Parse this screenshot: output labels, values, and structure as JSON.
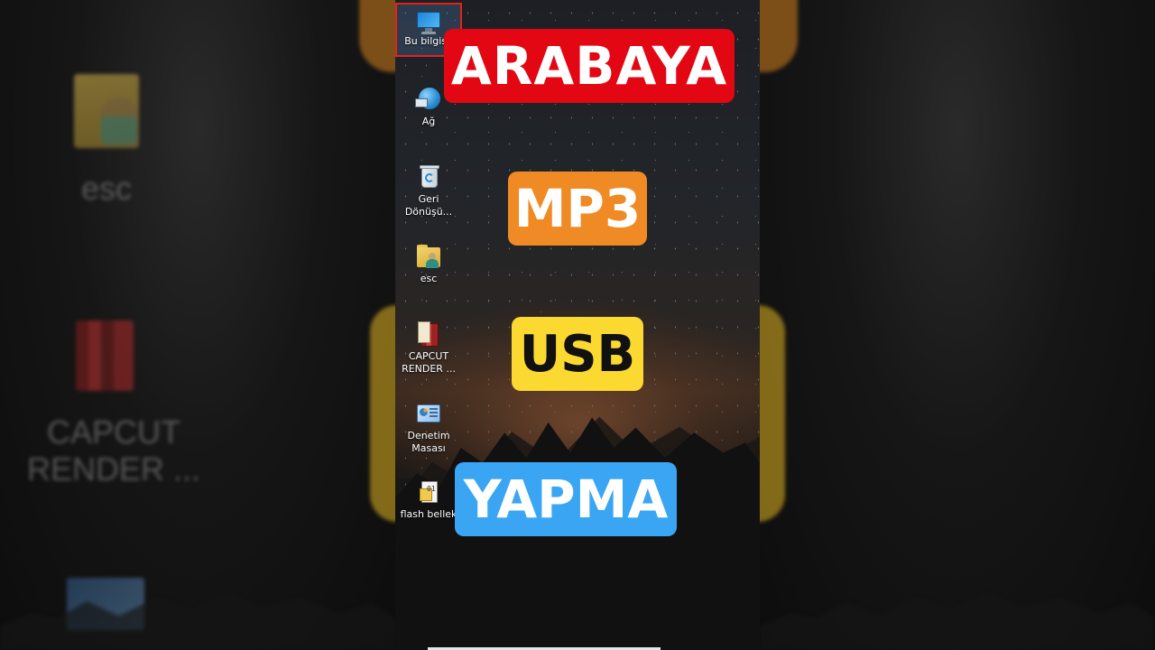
{
  "desktop_icons": [
    {
      "label": "Bu bilgisa",
      "icon": "computer-icon",
      "selected": true
    },
    {
      "label": "Ağ",
      "icon": "network-icon"
    },
    {
      "label": "Geri\nDönüşü...",
      "icon": "recycle-bin-icon"
    },
    {
      "label": "esc",
      "icon": "user-folder-icon"
    },
    {
      "label": "CAPCUT\nRENDER ...",
      "icon": "winrar-archive-icon"
    },
    {
      "label": "Denetim\nMasası",
      "icon": "control-panel-icon"
    },
    {
      "label": "flash bellek",
      "icon": "text-file-icon"
    }
  ],
  "captions": {
    "line1": "ARABAYA",
    "line2": "MP3",
    "line3": "USB",
    "line4": "YAPMA"
  },
  "background_blur": {
    "left_text_1": "esc",
    "left_text_2": "CAPCUT\nRENDER ..."
  },
  "colors": {
    "caption1_bg": "#e30613",
    "caption2_bg": "#f08a24",
    "caption3_bg": "#fbd930",
    "caption4_bg": "#3aa6f3",
    "selection_border": "#e2231a"
  }
}
